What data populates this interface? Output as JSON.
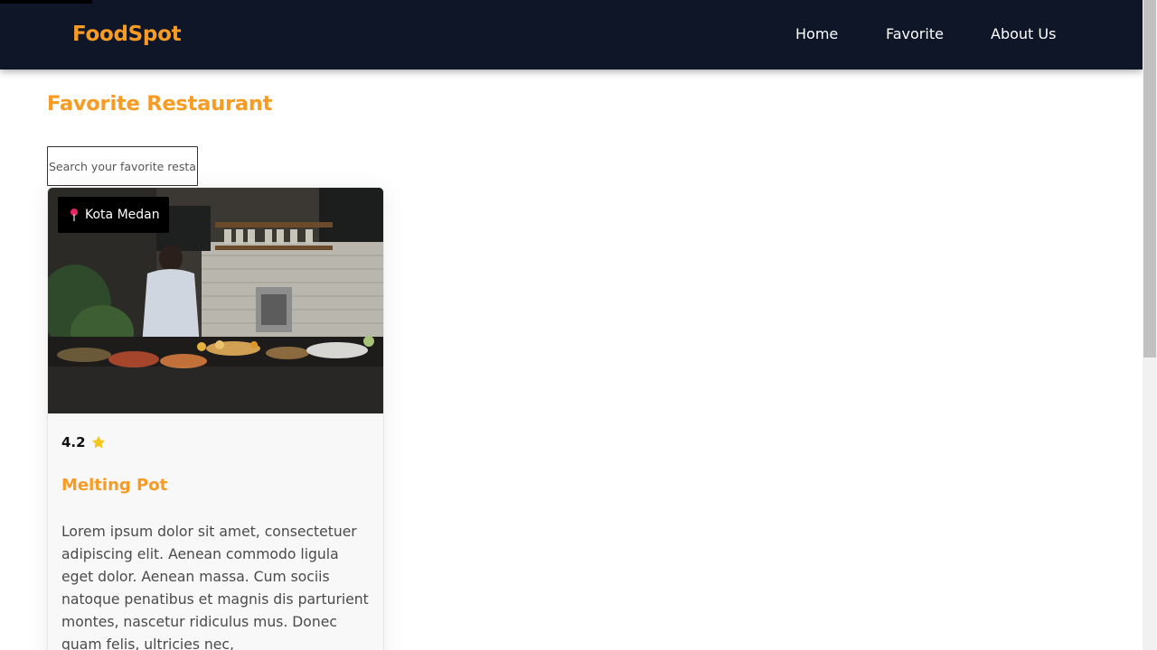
{
  "colors": {
    "accent": "#f79b23",
    "navbar_bg": "#0e1628",
    "star": "#f5c518",
    "pin": "#e7245f"
  },
  "header": {
    "brand": "FoodSpot",
    "nav": [
      {
        "label": "Home"
      },
      {
        "label": "Favorite"
      },
      {
        "label": "About Us"
      }
    ]
  },
  "main": {
    "title": "Favorite Restaurant",
    "search": {
      "placeholder": "Search your favorite restaurant",
      "value": ""
    },
    "cards": [
      {
        "city": "Kota Medan",
        "rating": "4.2",
        "name": "Melting Pot",
        "description": "Lorem ipsum dolor sit amet, consectetuer adipiscing elit. Aenean commodo ligula eget dolor. Aenean massa. Cum sociis natoque penatibus et magnis dis parturient montes, nascetur ridiculus mus. Donec quam felis, ultricies nec,",
        "icons": {
          "city": "map-pin-icon",
          "rating": "star-icon"
        }
      }
    ]
  }
}
